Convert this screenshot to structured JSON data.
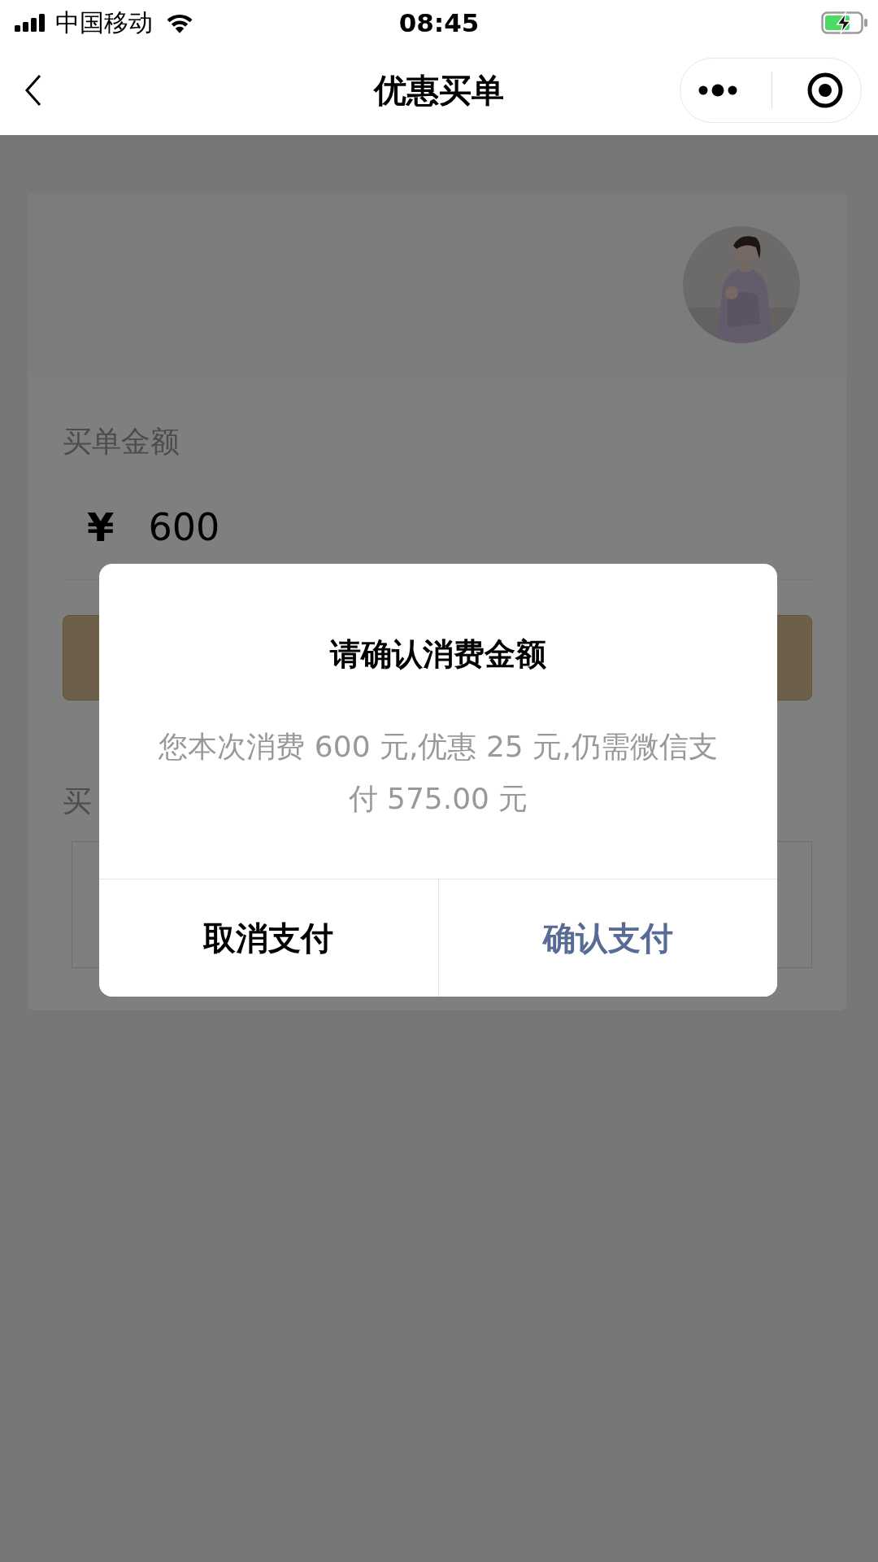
{
  "status_bar": {
    "carrier": "中国移动",
    "time": "08:45",
    "charging": true
  },
  "nav": {
    "title": "优惠买单"
  },
  "card": {
    "amount_label": "买单金额",
    "currency": "¥",
    "amount": "600",
    "second_label": "买"
  },
  "dialog": {
    "title": "请确认消费金额",
    "message": "您本次消费 600 元,优惠 25 元,仍需微信支付 575.00 元",
    "buttons": [
      {
        "label": "取消支付",
        "kind": "cancel"
      },
      {
        "label": "确认支付",
        "kind": "confirm"
      }
    ]
  }
}
